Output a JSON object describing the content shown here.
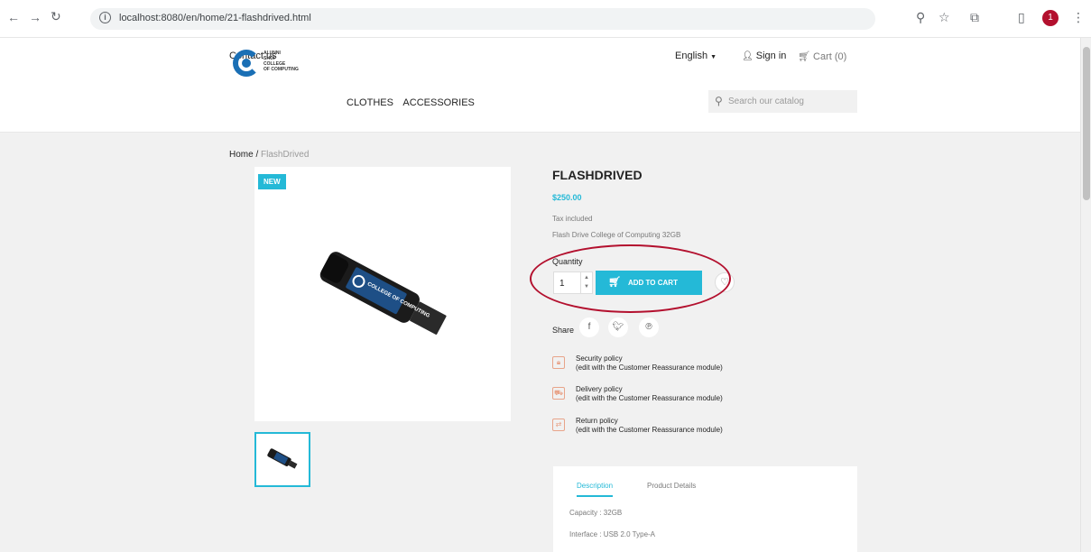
{
  "browser": {
    "url": "localhost:8080/en/home/21-flashdrived.html",
    "profile_initial": "1"
  },
  "header": {
    "contact": "Contact us",
    "language": "English",
    "signin": "Sign in",
    "cart": "Cart (0)",
    "logo_text": [
      "ALUNNI",
      "SHOP",
      "COLLEGE",
      "OF COMPUTING"
    ],
    "menu": [
      "CLOTHES",
      "ACCESSORIES"
    ],
    "search_placeholder": "Search our catalog"
  },
  "breadcrumb": {
    "home": "Home",
    "current": "FlashDrived"
  },
  "product": {
    "badge": "NEW",
    "title": "FLASHDRIVED",
    "price": "$250.00",
    "tax": "Tax included",
    "short_description": "Flash Drive College of Computing 32GB",
    "quantity_label": "Quantity",
    "quantity_value": "1",
    "add_to_cart": "ADD TO CART",
    "share_label": "Share",
    "drive_label": "COLLEGE OF COMPUTING"
  },
  "reassurance": [
    {
      "title": "Security policy",
      "sub": "(edit with the Customer Reassurance module)",
      "icon": "lock-icon"
    },
    {
      "title": "Delivery policy",
      "sub": "(edit with the Customer Reassurance module)",
      "icon": "truck-icon"
    },
    {
      "title": "Return policy",
      "sub": "(edit with the Customer Reassurance module)",
      "icon": "return-icon"
    }
  ],
  "tabs": {
    "description": "Description",
    "details": "Product Details",
    "capacity": "Capacity : 32GB",
    "interface": "Interface : USB 2.0 Type-A"
  },
  "colors": {
    "accent": "#24b9d7",
    "annotation": "#b3102e",
    "logo_blue": "#1a6fb5"
  }
}
